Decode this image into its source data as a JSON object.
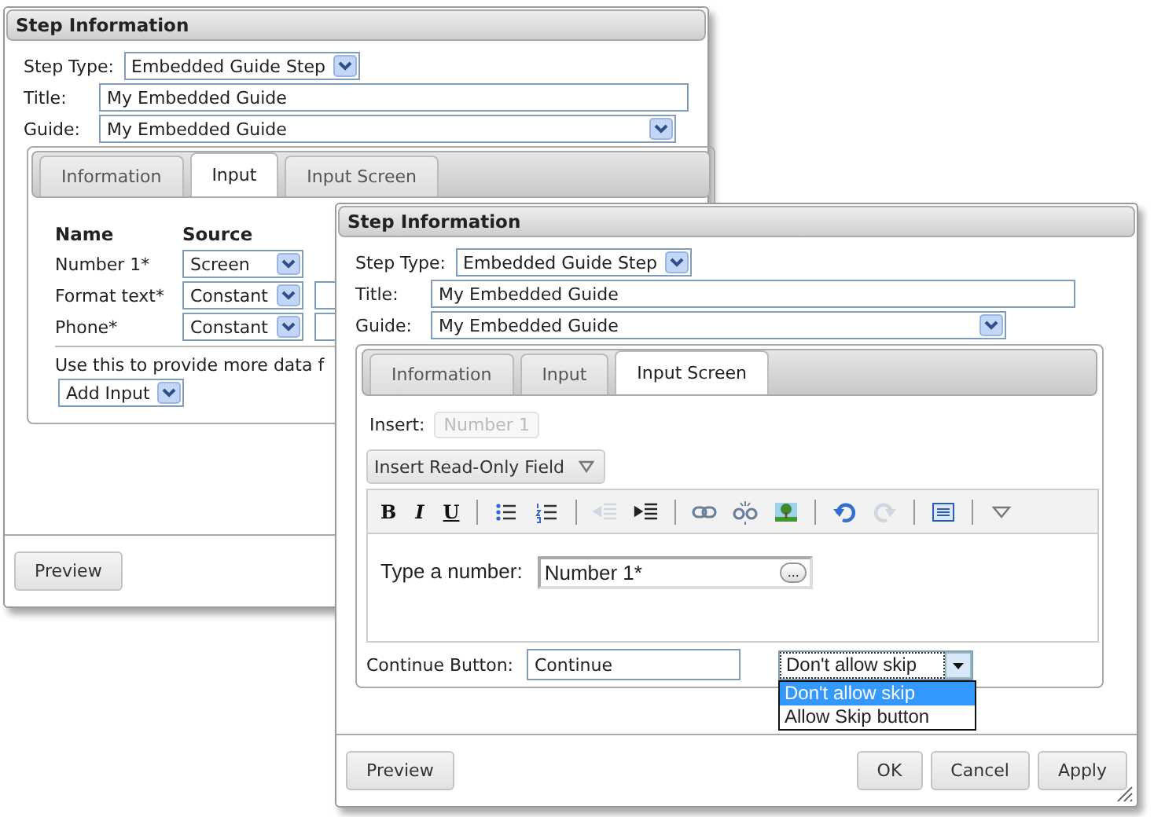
{
  "back_window": {
    "title": "Step Information",
    "fields": [
      {
        "label": "Step Type:",
        "value": "Embedded Guide Step",
        "kind": "select"
      },
      {
        "label": "Title:",
        "value": "My Embedded Guide",
        "kind": "text"
      },
      {
        "label": "Guide:",
        "value": "My Embedded Guide",
        "kind": "select"
      }
    ],
    "tabs": [
      {
        "label": "Information",
        "selected": false
      },
      {
        "label": "Input",
        "selected": true
      },
      {
        "label": "Input Screen",
        "selected": false
      }
    ],
    "inputs": {
      "columns": [
        "Name",
        "Source"
      ],
      "rows": [
        {
          "name": "Number 1*",
          "source": "Screen",
          "value_field": false
        },
        {
          "name": "Format text*",
          "source": "Constant",
          "value_field": true
        },
        {
          "name": "Phone*",
          "source": "Constant",
          "value_field": true
        }
      ]
    },
    "note": "Use this to provide more data f",
    "add_input": "Add Input",
    "footer_buttons": [
      "Preview"
    ]
  },
  "front_window": {
    "title": "Step Information",
    "fields": [
      {
        "label": "Step Type:",
        "value": "Embedded Guide Step",
        "kind": "select"
      },
      {
        "label": "Title:",
        "value": "My Embedded Guide",
        "kind": "text"
      },
      {
        "label": "Guide:",
        "value": "My Embedded Guide",
        "kind": "select"
      }
    ],
    "tabs": [
      {
        "label": "Information",
        "selected": false
      },
      {
        "label": "Input",
        "selected": false
      },
      {
        "label": "Input Screen",
        "selected": true
      }
    ],
    "insert_label": "Insert:",
    "insert_chip": {
      "text": "Number 1",
      "disabled": true
    },
    "insert_menu": "Insert Read-Only Field",
    "toolbar": [
      {
        "kind": "bold",
        "label": "B"
      },
      {
        "kind": "italic",
        "label": "I"
      },
      {
        "kind": "underline",
        "label": "U"
      },
      {
        "kind": "separator"
      },
      {
        "kind": "bullet-list",
        "disabled": false
      },
      {
        "kind": "numbered-list",
        "disabled": false
      },
      {
        "kind": "separator"
      },
      {
        "kind": "outdent",
        "disabled": true
      },
      {
        "kind": "indent",
        "disabled": false
      },
      {
        "kind": "separator"
      },
      {
        "kind": "link",
        "disabled": false
      },
      {
        "kind": "unlink",
        "disabled": false
      },
      {
        "kind": "image",
        "disabled": false
      },
      {
        "kind": "separator"
      },
      {
        "kind": "undo",
        "disabled": false
      },
      {
        "kind": "redo",
        "disabled": true
      },
      {
        "kind": "separator"
      },
      {
        "kind": "panel",
        "disabled": false
      },
      {
        "kind": "separator"
      },
      {
        "kind": "more",
        "disabled": false
      }
    ],
    "editor": {
      "prompt": "Type a number:",
      "field": "Number 1*",
      "field_button": "..."
    },
    "continue": {
      "label": "Continue Button:",
      "value": "Continue",
      "skip": "Don't allow skip",
      "open": true,
      "options": [
        {
          "label": "Don't allow skip",
          "selected": true
        },
        {
          "label": "Allow Skip button",
          "selected": false
        }
      ]
    },
    "footer_left": [
      "Preview"
    ],
    "footer_right": [
      "OK",
      "Cancel",
      "Apply"
    ]
  }
}
